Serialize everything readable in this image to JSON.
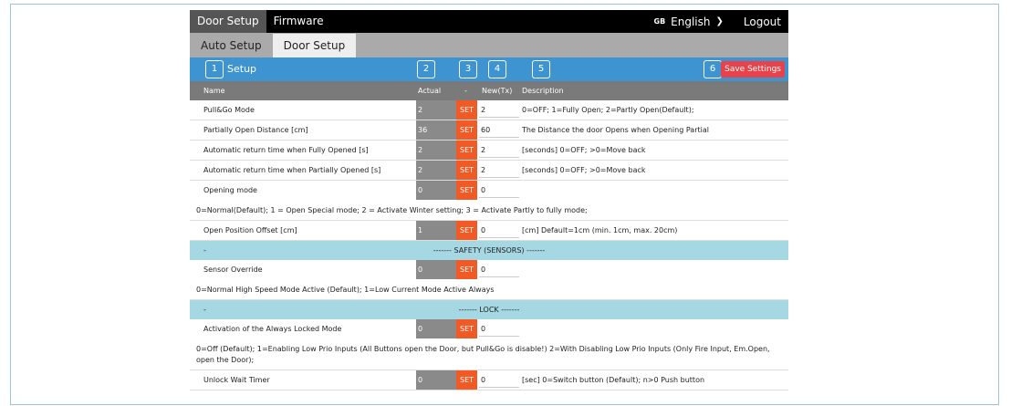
{
  "topbar": {
    "tabs": [
      "Door Setup",
      "Firmware"
    ],
    "flag": "GB",
    "language": "English",
    "logout": "Logout"
  },
  "subtabs": [
    "Auto Setup",
    "Door Setup"
  ],
  "panel": {
    "title": "Setup",
    "markers": [
      "1",
      "2",
      "3",
      "4",
      "5",
      "6"
    ],
    "save_label": "Save Settings"
  },
  "columns": {
    "name": "Name",
    "actual": "Actual",
    "set": "-",
    "new": "New(Tx)",
    "description": "Description"
  },
  "set_label": "SET",
  "rows": [
    {
      "name": "Pull&Go Mode",
      "actual": "2",
      "new": "2",
      "desc": "0=OFF; 1=Fully Open; 2=Partly Open(Default);"
    },
    {
      "name": "Partially Open Distance [cm]",
      "actual": "36",
      "new": "60",
      "desc": "The Distance the door Opens when Opening Partial"
    },
    {
      "name": "Automatic return time when Fully Opened [s]",
      "actual": "2",
      "new": "2",
      "desc": "[seconds] 0=OFF; >0=Move back"
    },
    {
      "name": "Automatic return time when Partially Opened [s]",
      "actual": "2",
      "new": "2",
      "desc": "[seconds] 0=OFF; >0=Move back"
    },
    {
      "name": "Opening mode",
      "actual": "0",
      "new": "0",
      "desc": ""
    },
    {
      "name": "Open Position Offset [cm]",
      "actual": "1",
      "new": "0",
      "desc": "[cm] Default=1cm (min. 1cm, max. 20cm)"
    },
    {
      "name": "Sensor Override",
      "actual": "0",
      "new": "0",
      "desc": ""
    },
    {
      "name": "Activation of the Always Locked Mode",
      "actual": "0",
      "new": "0",
      "desc": ""
    },
    {
      "name": "Unlock Wait Timer",
      "actual": "0",
      "new": "0",
      "desc": "[sec] 0=Switch button (Default); n>0 Push button"
    }
  ],
  "notes": {
    "opening_mode": "0=Normal(Default); 1 = Open Special mode; 2 = Activate Winter setting; 3 = Activate Partly to fully mode;",
    "sensor_override": "0=Normal High Speed Mode Active (Default); 1=Low Current Mode Active Always",
    "always_locked": "0=Off (Default); 1=Enabling Low Prio Inputs (All Buttons open the Door, but Pull&Go is disable!) 2=With Disabling Low Prio Inputs (Only Fire Input, Em.Open, open the Door);"
  },
  "sections": {
    "dash": "-",
    "safety": "------- SAFETY (SENSORS) -------",
    "lock": "------- LOCK -------"
  },
  "colors": {
    "topbar": "#000000",
    "panel_header": "#3e94d0",
    "set_button": "#f15a24",
    "save_button": "#e8434a",
    "section_band": "#a6d8e4",
    "actual_cell": "#8a8a8a"
  }
}
